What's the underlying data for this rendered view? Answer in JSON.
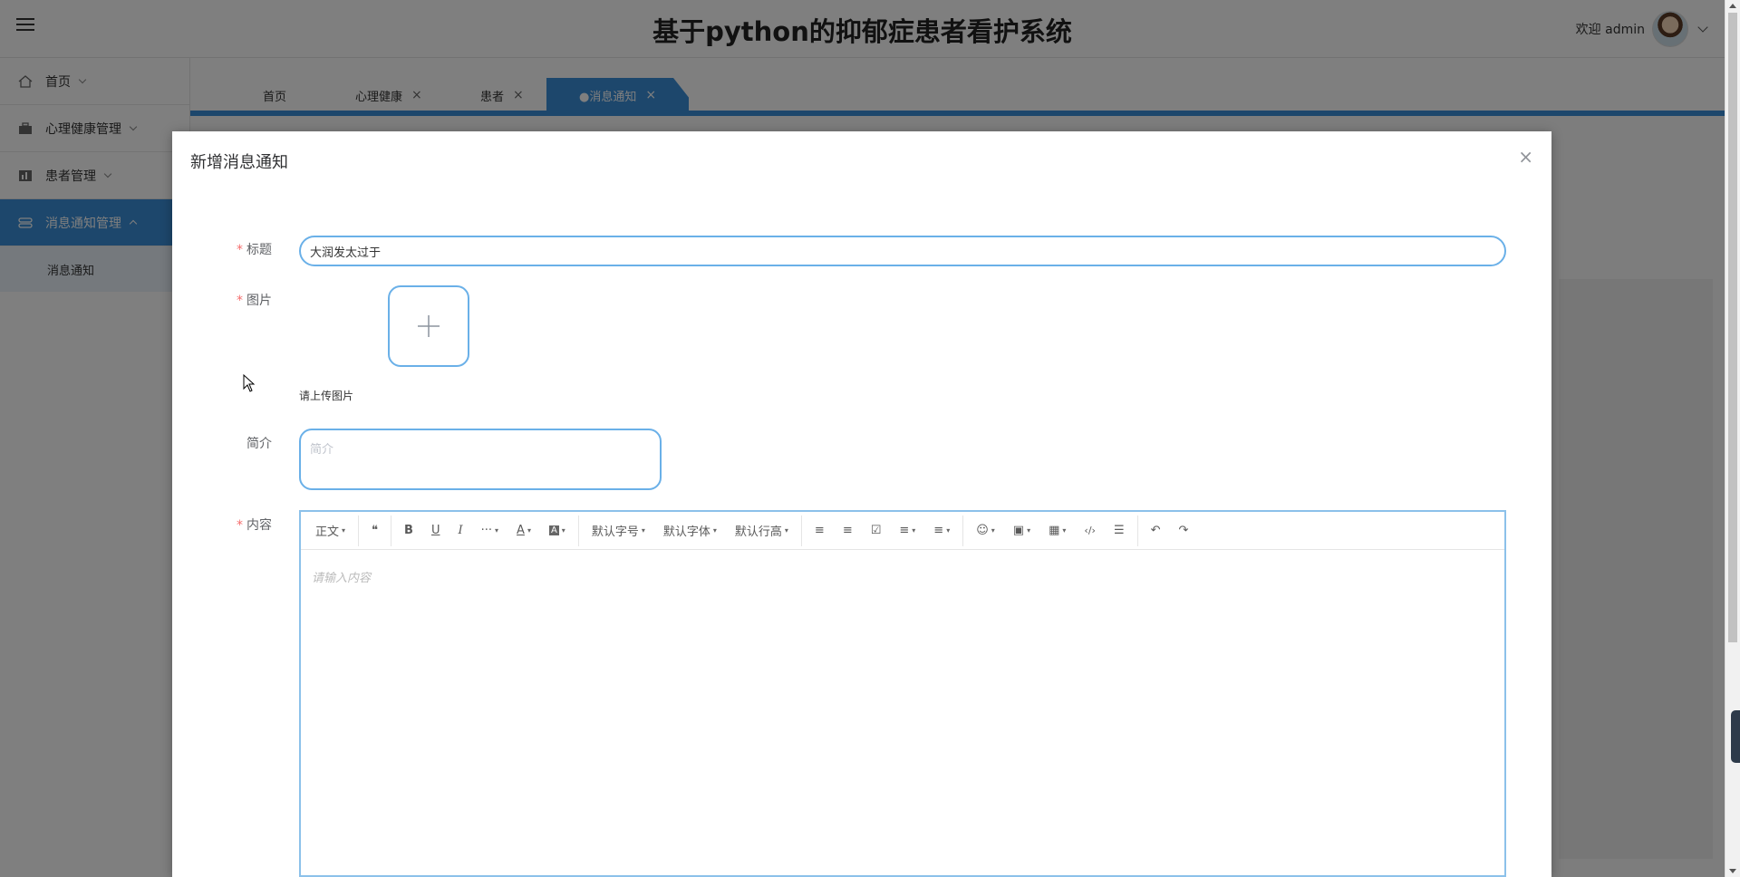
{
  "header": {
    "title": "基于python的抑郁症患者看护系统",
    "welcome": "欢迎 admin"
  },
  "sidebar": {
    "items": [
      {
        "label": "首页",
        "icon": "home-icon"
      },
      {
        "label": "心理健康管理",
        "icon": "briefcase-icon"
      },
      {
        "label": "患者管理",
        "icon": "chart-icon"
      },
      {
        "label": "消息通知管理",
        "icon": "toggle-icon"
      }
    ],
    "sub_item": "消息通知"
  },
  "tabs": [
    {
      "label": "首页"
    },
    {
      "label": "心理健康",
      "close": "×"
    },
    {
      "label": "患者",
      "close": "×"
    },
    {
      "label": "●消息通知",
      "close": "×"
    }
  ],
  "dialog": {
    "title": "新增消息通知",
    "close": "×",
    "form": {
      "title_label": "标题",
      "title_value": "大润发太过于",
      "image_label": "图片",
      "upload_plus": "+",
      "upload_tip": "请上传图片",
      "summary_label": "简介",
      "summary_placeholder": "简介",
      "content_label": "内容",
      "required_mark": "*"
    },
    "editor": {
      "toolbar": {
        "paragraph": "正文",
        "quote": "❝",
        "bold": "B",
        "underline": "U",
        "italic": "I",
        "more": "···",
        "font_color": "A",
        "bg_color": "A",
        "font_size": "默认字号",
        "font_family": "默认字体",
        "line_height": "默认行高",
        "bullet_list": "≡",
        "numbered_list": "≡",
        "todo": "☑",
        "align": "≡",
        "indent": "≡",
        "emotion": "☺",
        "image": "▣",
        "table": "▦",
        "code": "‹/›",
        "divider": "☰",
        "undo": "↶",
        "redo": "↷",
        "dropdown": "▾"
      },
      "placeholder": "请输入内容"
    }
  }
}
